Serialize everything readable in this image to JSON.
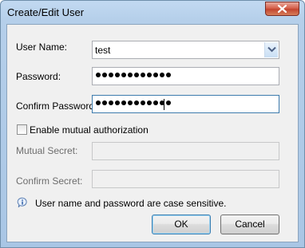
{
  "window": {
    "title": "Create/Edit User",
    "close_icon": "close-icon"
  },
  "form": {
    "user_name_label": "User Name:",
    "user_name_value": "test",
    "password_label": "Password:",
    "password_masked_length": 12,
    "confirm_password_label": "Confirm Password:",
    "confirm_password_masked_length": 12,
    "mutual_auth_label": "Enable mutual authorization",
    "mutual_auth_checked": false,
    "mutual_secret_label": "Mutual Secret:",
    "mutual_secret_value": "",
    "confirm_secret_label": "Confirm Secret:",
    "confirm_secret_value": ""
  },
  "info": {
    "icon": "info-icon",
    "text": "User name and password are case sensitive."
  },
  "buttons": {
    "ok_label": "OK",
    "cancel_label": "Cancel"
  },
  "colors": {
    "titlebar": "#b5cfea",
    "close_button": "#c2452f",
    "dialog_background": "#f0f0f0",
    "default_button_border": "#3c7fb1"
  }
}
